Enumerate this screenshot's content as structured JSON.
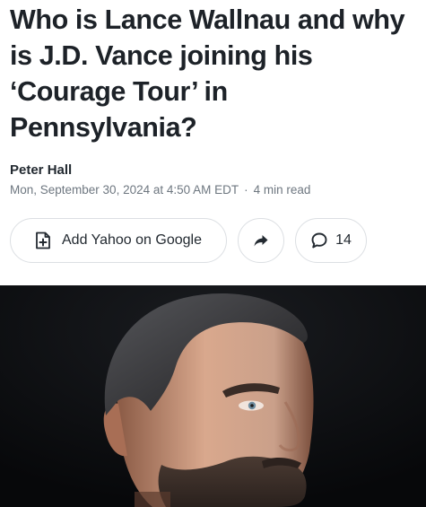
{
  "headline": "Who is Lance Wallnau and why is J.D. Vance joining his ‘Courage Tour’ in Pennsylvania?",
  "author": "Peter Hall",
  "meta": {
    "date": "Mon, September 30, 2024 at 4:50 AM EDT",
    "separator": "·",
    "read_time": "4 min read"
  },
  "actions": {
    "google_label": "Add Yahoo on Google",
    "google_icon": "plus-document-icon",
    "share_icon": "share-arrow-icon",
    "comment_icon": "comment-bubble-icon",
    "comment_count": "14"
  },
  "colors": {
    "text": "#1d2228",
    "meta": "#6e7780",
    "border": "#dcdfe3",
    "photo_bg": "#0c0d0f"
  }
}
